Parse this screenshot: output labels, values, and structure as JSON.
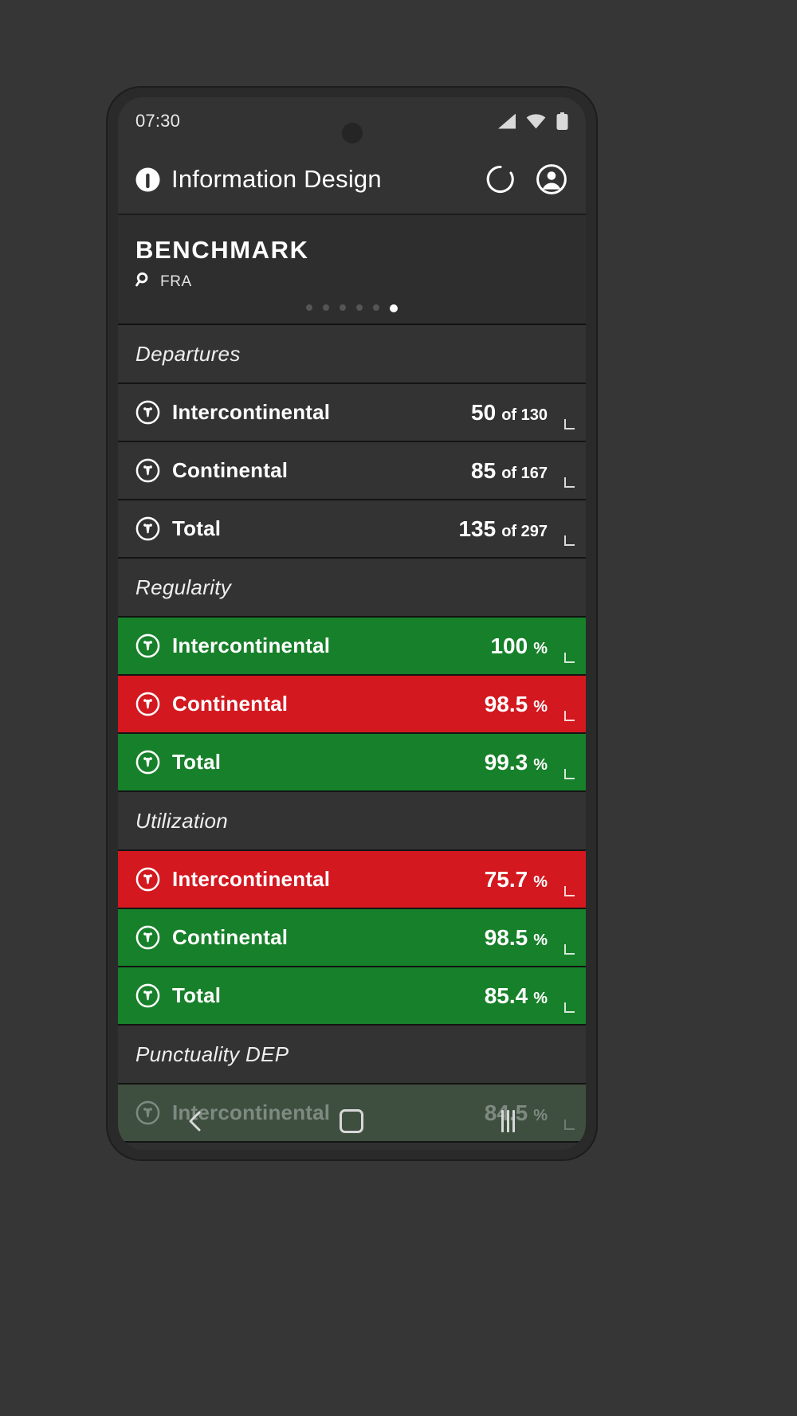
{
  "status_bar": {
    "time": "07:30",
    "icons": [
      "signal-icon",
      "wifi-icon",
      "battery-icon"
    ]
  },
  "app_bar": {
    "logo": "app-logo-icon",
    "title": "Information Design",
    "actions": [
      {
        "name": "refresh-icon"
      },
      {
        "name": "account-icon"
      }
    ]
  },
  "benchmark": {
    "title": "BENCHMARK",
    "search_icon": "search-icon",
    "filter": "FRA",
    "dots_total": 6,
    "dots_active_index": 5
  },
  "sections": [
    {
      "heading": "Departures",
      "rows": [
        {
          "label": "Intercontinental",
          "value": "50",
          "unit": "of 130",
          "state": "neutral"
        },
        {
          "label": "Continental",
          "value": "85",
          "unit": "of 167",
          "state": "neutral"
        },
        {
          "label": "Total",
          "value": "135",
          "unit": "of 297",
          "state": "neutral"
        }
      ]
    },
    {
      "heading": "Regularity",
      "rows": [
        {
          "label": "Intercontinental",
          "value": "100",
          "unit": "%",
          "state": "good"
        },
        {
          "label": "Continental",
          "value": "98.5",
          "unit": "%",
          "state": "bad"
        },
        {
          "label": "Total",
          "value": "99.3",
          "unit": "%",
          "state": "good"
        }
      ]
    },
    {
      "heading": "Utilization",
      "rows": [
        {
          "label": "Intercontinental",
          "value": "75.7",
          "unit": "%",
          "state": "bad"
        },
        {
          "label": "Continental",
          "value": "98.5",
          "unit": "%",
          "state": "good"
        },
        {
          "label": "Total",
          "value": "85.4",
          "unit": "%",
          "state": "good"
        }
      ]
    },
    {
      "heading": "Punctuality DEP",
      "rows": [
        {
          "label": "Intercontinental",
          "value": "84.5",
          "unit": "%",
          "state": "dim"
        }
      ]
    }
  ],
  "nav_bar": {
    "recents": "recents-icon",
    "home": "home-icon",
    "back": "back-icon"
  },
  "colors": {
    "good": "#17802a",
    "bad": "#d3181f",
    "neutral": "#333333",
    "page_bg": "#363636"
  }
}
